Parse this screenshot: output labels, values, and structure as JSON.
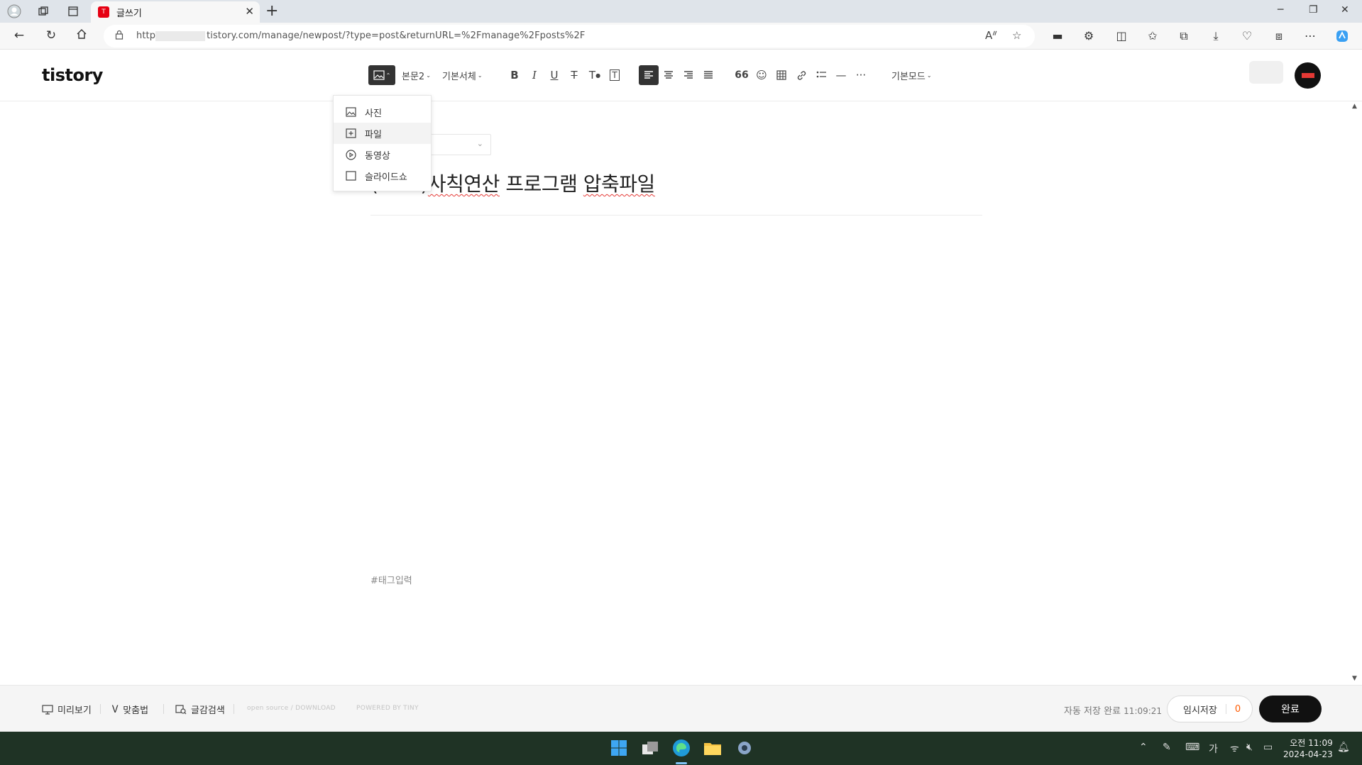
{
  "browser": {
    "tab_title": "글쓰기",
    "tab_favicon_text": "T",
    "url_prefix": "http",
    "url_rest": "tistory.com/manage/newpost/?type=post&returnURL=%2Fmanage%2Fposts%2F"
  },
  "editor": {
    "logo": "tistory",
    "toolbar": {
      "paragraph_style": "본문2",
      "font": "기본서체",
      "mode": "기본모드",
      "quote_glyph": "66"
    },
    "media_menu": {
      "items": [
        {
          "label": "사진",
          "icon": "image-icon"
        },
        {
          "label": "파일",
          "icon": "file-add-icon"
        },
        {
          "label": "동영상",
          "icon": "play-circle-icon"
        },
        {
          "label": "슬라이드쇼",
          "icon": "slideshow-icon"
        }
      ]
    },
    "title_prefix": "(",
    "title_visible": ")사칙연산 프로그램 압축파일",
    "title_word1": "사칙연산",
    "title_word2": "프로그램",
    "title_word3": "압축파일",
    "tag_placeholder": "#태그입력"
  },
  "footer": {
    "preview": "미리보기",
    "spellcheck": "맞춤법",
    "search": "글감검색",
    "opensource": "open source / DOWNLOAD",
    "powered": "POWERED BY TINY",
    "autosave_label": "자동 저장 완료",
    "autosave_time": "11:09:21",
    "draft_label": "임시저장",
    "draft_count": "0",
    "done_label": "완료"
  },
  "taskbar": {
    "time": "오전 11:09",
    "date": "2024-04-23",
    "ime": "가"
  },
  "colors": {
    "accent_orange": "#ff5a00",
    "taskbar_bg": "#1f3325",
    "tistory_red": "#e60012"
  }
}
